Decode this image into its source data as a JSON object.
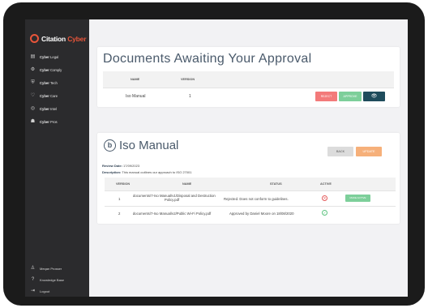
{
  "brand": {
    "name_main": "Citation",
    "name_accent": " Cyber"
  },
  "sidebar": {
    "items": [
      {
        "bold": "Cyber",
        "rest": " Legal",
        "icon": "document-icon"
      },
      {
        "bold": "Cyber",
        "rest": " Comply",
        "icon": "gear-icon"
      },
      {
        "bold": "Cyber",
        "rest": " Tech",
        "icon": "shield-icon"
      },
      {
        "bold": "Cyber",
        "rest": " Care",
        "icon": "heart-icon"
      },
      {
        "bold": "Cyber",
        "rest": " Intel",
        "icon": "target-icon"
      },
      {
        "bold": "Cyber",
        "rest": " Pros",
        "icon": "users-icon"
      }
    ],
    "bottom": [
      {
        "label": "Meqan Prosser",
        "icon": "user-icon"
      },
      {
        "label": "Knowledge Base",
        "icon": "help-icon"
      },
      {
        "label": "Logout",
        "icon": "logout-icon"
      }
    ]
  },
  "approval": {
    "title": "Documents Awaiting Your Approval",
    "headers": {
      "name": "NAME",
      "version": "VERSION"
    },
    "row": {
      "name": "Iso Manual",
      "version": "1"
    },
    "reject_label": "REJECT",
    "approve_label": "APPROVE",
    "view_icon": "eye-icon"
  },
  "document": {
    "logo_letter": "b",
    "title": "Iso Manual",
    "back_label": "BACK",
    "update_label": "UPDATE",
    "review_label": "Review Date:",
    "review_value": "17/09/2023",
    "description_label": "Description:",
    "description_value": "This manual outlines our approach to ISO 27001",
    "headers": {
      "version": "VERSION",
      "name": "NAME",
      "status": "STATUS",
      "active": "ACTIVE"
    },
    "rows": [
      {
        "version": "1",
        "name_line1": "documents/7-Iso Manual/v1/Disposal and Destruction",
        "name_line2": "Policy.pdf",
        "status": "Rejected. Does not conform to guidelines.",
        "active_icon": "x-circle-icon",
        "action_label": "MAKE ACTIVE"
      },
      {
        "version": "2",
        "name_line1": "documents/7-Iso Manual/v2/Public Wi-Fi Policy.pdf",
        "name_line2": "",
        "status": "Approved by Daniel Moore on 18/08/2020",
        "active_icon": "check-circle-icon",
        "action_label": ""
      }
    ]
  },
  "colors": {
    "accent": "#e8553a",
    "sidebar": "#2b2b2d",
    "title": "#4a5a6b",
    "reject": "#f37a7a",
    "approve": "#7dcf9a",
    "view": "#1f4c5c",
    "update": "#f6b07a"
  }
}
